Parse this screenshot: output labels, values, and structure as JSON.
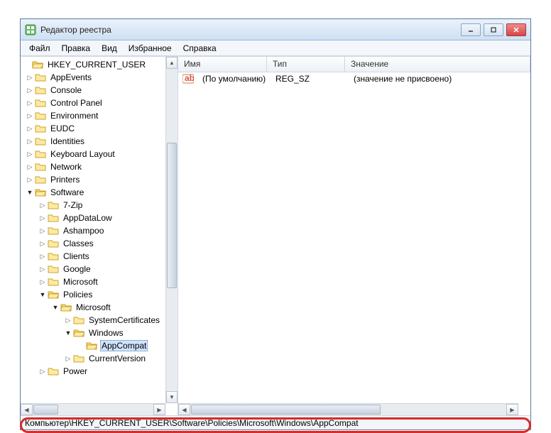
{
  "window": {
    "title": "Редактор реестра"
  },
  "menu": {
    "file": "Файл",
    "edit": "Правка",
    "view": "Вид",
    "fav": "Избранное",
    "help": "Справка"
  },
  "tree": {
    "root": "HKEY_CURRENT_USER",
    "items": [
      "AppEvents",
      "Console",
      "Control Panel",
      "Environment",
      "EUDC",
      "Identities",
      "Keyboard Layout",
      "Network",
      "Printers"
    ],
    "software": "Software",
    "sw_items": [
      "7-Zip",
      "AppDataLow",
      "Ashampoo",
      "Classes",
      "Clients",
      "Google",
      "Microsoft"
    ],
    "policies": "Policies",
    "pol_ms": "Microsoft",
    "pol_syscert": "SystemCertificates",
    "pol_win": "Windows",
    "appcompat": "AppCompat",
    "curver": "CurrentVersion",
    "power": "Power"
  },
  "list": {
    "cols": {
      "name": "Имя",
      "type": "Тип",
      "value": "Значение"
    },
    "row": {
      "name": "(По умолчанию)",
      "type": "REG_SZ",
      "value": "(значение не присвоено)"
    }
  },
  "statusbar": {
    "path": "Компьютер\\HKEY_CURRENT_USER\\Software\\Policies\\Microsoft\\Windows\\AppCompat"
  }
}
